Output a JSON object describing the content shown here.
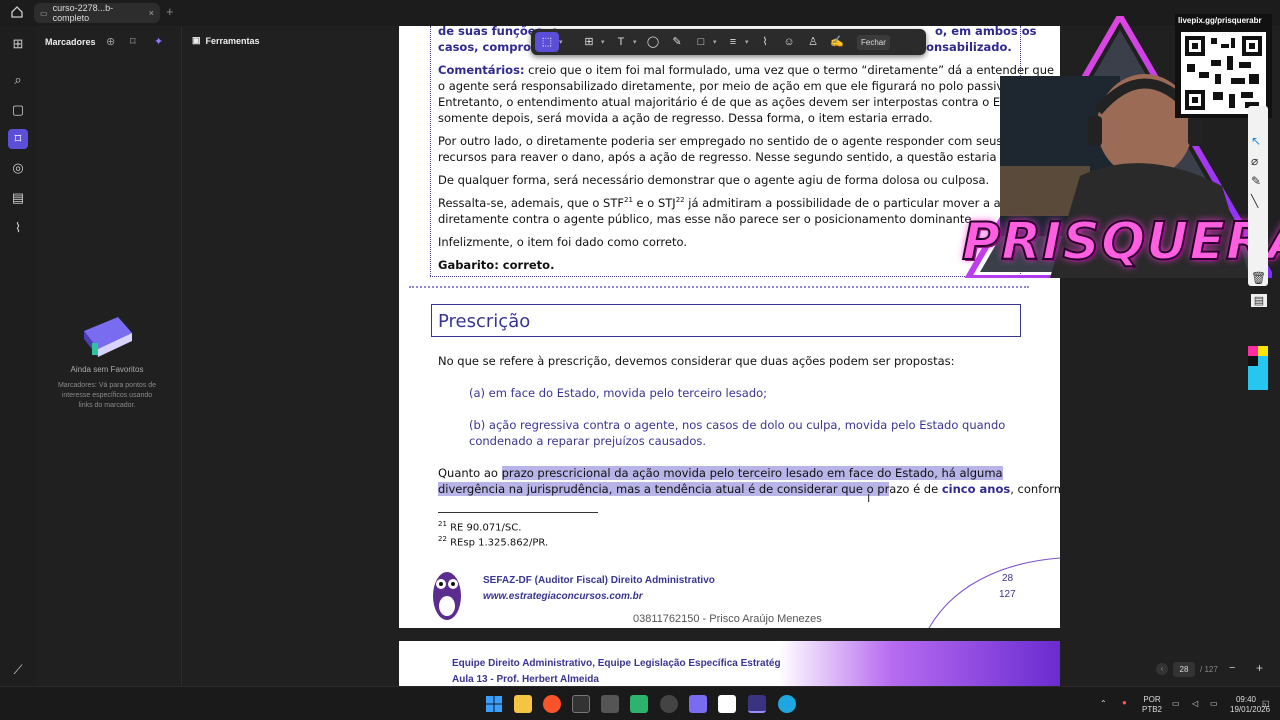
{
  "window": {
    "tab_title": "curso-2278...b-completo",
    "tab_close": "×",
    "new_tab": "+"
  },
  "sidebar": {
    "title": "Marcadores",
    "empty_title": "Ainda sem Favoritos",
    "empty_desc": "Marcadores: Vá para pontos de interesse específicos usando links do marcador.",
    "nav_dots": "···"
  },
  "tools_label": "Ferramentas",
  "toolbar": {
    "close_label": "Fechar"
  },
  "document": {
    "top_lines": [
      {
        "text": "de suas funções, e",
        "tail": "o, em ambos os"
      },
      {
        "text": "casos, comprovar",
        "tail": "sponsabilizado."
      }
    ],
    "comment_label": "Comentários:",
    "comment_lines": [
      " creio que o item foi mal formulado, uma vez que o termo “diretamente” dá a entender que",
      "o agente será responsabilizado diretamente, por meio de ação em que ele figurará no polo passivo da lide.",
      "Entretanto, o entendimento atual majoritário é de que as ações devem ser interpostas contra o Estado e,",
      "somente depois, será movida a ação de regresso. Dessa forma, o item estaria errado."
    ],
    "para2": [
      "Por outro lado, o diretamente poderia ser empregado no sentido de o agente responder com seus próprios",
      "recursos para reaver o dano, após a ação de regresso. Nesse segundo sentido, a questão estaria correta."
    ],
    "para3": "De qualquer forma, será necessário demonstrar que o agente agiu de forma dolosa ou culposa.",
    "para4_a": "Ressalta-se, ademais, que o STF",
    "sup21": "21",
    "para4_b": " e o STJ",
    "sup22": "22",
    "para4_c": " já admitiram a possibilidade de o particular mover a a",
    "para4_line2": "diretamente contra o agente público, mas esse não parece ser o posicionamento dominante.",
    "para5": "Infelizmente, o item foi dado como correto.",
    "gabarito": "Gabarito: correto.",
    "section_title": "Prescrição",
    "intro": "No que se refere à prescrição, devemos considerar que duas ações podem ser propostas:",
    "item_a": "(a) em face do Estado, movida pelo terceiro lesado;",
    "item_b_1": "(b) ação regressiva contra o agente, nos casos de dolo ou culpa, movida pelo Estado quando",
    "item_b_2": "condenado a reparar prejuízos causados.",
    "quanto_pre": "Quanto ao ",
    "quanto_hl": "prazo prescricional da ação movida pelo terceiro lesado em face do Estado, há alguma",
    "line2_hl": "divergência na jurisprudência, mas a tendência atual é de considerar que o pr",
    "line2_rest": "azo é de ",
    "line2_bold": "cinco anos",
    "line2_end": ", conforme",
    "footnote21": "RE 90.071/SC.",
    "footnote22": "REsp 1.325.862/PR.",
    "footer_course": "SEFAZ-DF (Auditor Fiscal) Direito Administrativo",
    "footer_site": "www.estrategiaconcursos.com.br",
    "page_num": "28",
    "page_total": "127",
    "owner": "03811762150 - Prisco Araújo Menezes",
    "next_header_1": "Equipe Direito Administrativo, Equipe Legislação Específica Estratég",
    "next_header_2": "Aula 13 - Prof. Herbert Almeida"
  },
  "pager": {
    "current": "28",
    "total": "/ 127",
    "minus": "−",
    "plus": "+"
  },
  "taskbar": {
    "lang": "POR",
    "lang2": "PTB2",
    "time": "09:40",
    "date": "19/01/2026"
  },
  "overlay": {
    "qr_label": "livepix.gg/prisquerabr",
    "brand": "PRISQUERA"
  },
  "colors": {
    "accent": "#5b4fd8",
    "doc_blue": "#2e2a8f",
    "highlight": "#b9b4e8",
    "brand_pink": "#ff5fe0"
  }
}
